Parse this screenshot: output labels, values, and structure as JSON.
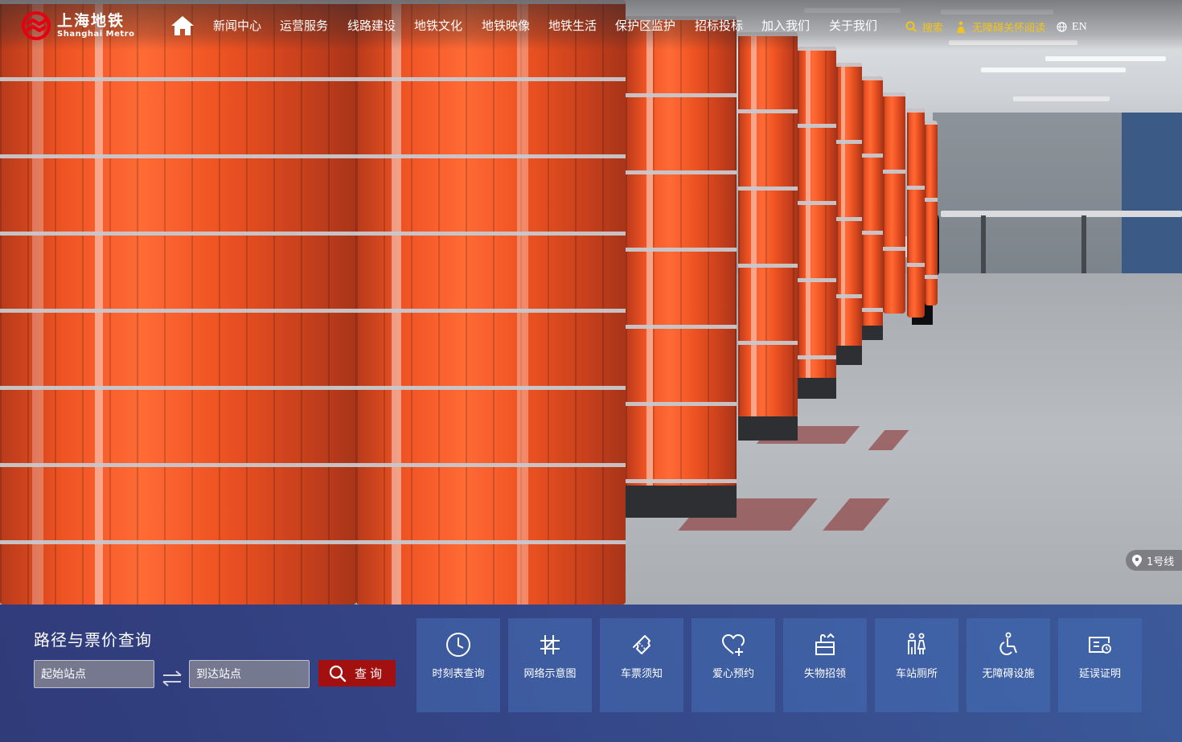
{
  "header": {
    "logo_cn": "上海地铁",
    "logo_en": "Shanghai Metro",
    "nav": [
      "新闻中心",
      "运营服务",
      "线路建设",
      "地铁文化",
      "地铁映像",
      "地铁生活",
      "保护区监护",
      "招标投标",
      "加入我们",
      "关于我们"
    ],
    "search_label": "搜索",
    "accessibility_label": "无障碍关怀阅读",
    "lang_label": "EN",
    "accent_color": "#f0c419"
  },
  "route_query": {
    "title": "路径与票价查询",
    "from_placeholder": "起始站点",
    "to_placeholder": "到达站点",
    "query_label": "查询",
    "button_color": "#a21010"
  },
  "services": [
    {
      "label": "时刻表查询",
      "icon": "clock-icon"
    },
    {
      "label": "网络示意图",
      "icon": "network-icon"
    },
    {
      "label": "车票须知",
      "icon": "ticket-icon"
    },
    {
      "label": "爱心预约",
      "icon": "heart-plus-icon"
    },
    {
      "label": "失物招领",
      "icon": "lost-found-icon"
    },
    {
      "label": "车站厕所",
      "icon": "restroom-icon"
    },
    {
      "label": "无障碍设施",
      "icon": "wheelchair-icon"
    },
    {
      "label": "延误证明",
      "icon": "delay-certificate-icon"
    }
  ],
  "photo_location": {
    "label": "1号线"
  }
}
